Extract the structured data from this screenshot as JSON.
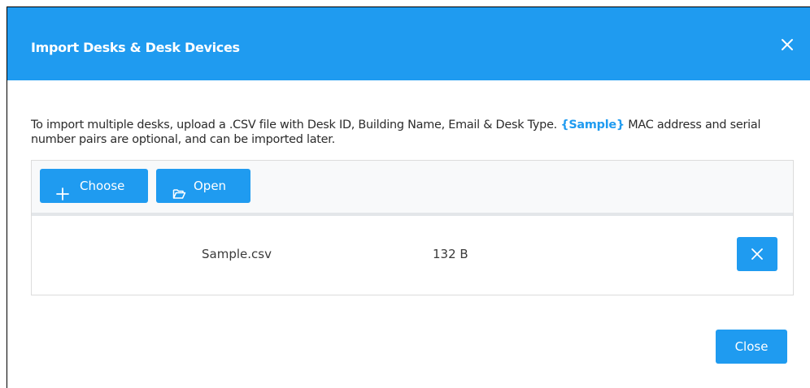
{
  "dialog": {
    "title": "Import Desks & Desk Devices",
    "close_icon": "close-icon"
  },
  "description": {
    "text_before": "To import multiple desks, upload a .CSV file with Desk ID, Building Name, Email & Desk Type. ",
    "sample_link": "{Sample}",
    "text_after": " MAC address and serial number pairs are optional, and can be imported later."
  },
  "upload": {
    "choose_label": "Choose",
    "choose_icon": "plus-icon",
    "open_label": "Open",
    "open_icon": "folder-open-icon",
    "files": [
      {
        "name": "Sample.csv",
        "size": "132 B",
        "remove_icon": "close-icon"
      }
    ]
  },
  "footer": {
    "close_label": "Close"
  },
  "colors": {
    "accent": "#1f9bf0",
    "text": "#2b2b2b",
    "toolbar_bg": "#f8f9fa",
    "border": "#dcdcdc"
  }
}
